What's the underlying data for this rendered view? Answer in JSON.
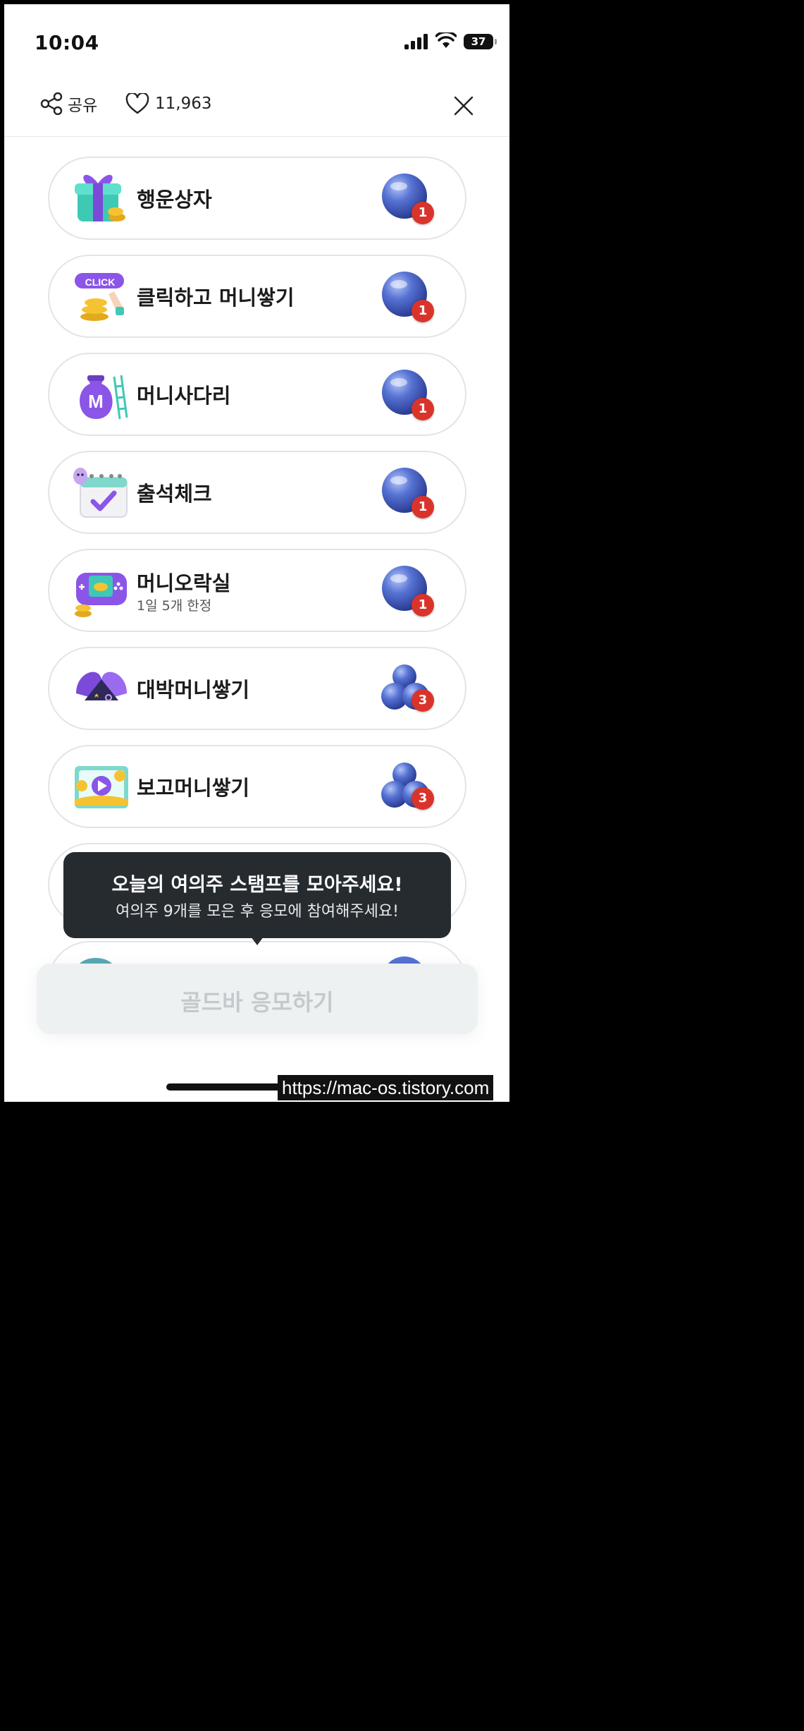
{
  "status_bar": {
    "time": "10:04",
    "battery": "37"
  },
  "header": {
    "share_label": "공유",
    "like_count": "11,963"
  },
  "items": [
    {
      "label": "행운상자",
      "icon": "gift-box-icon",
      "badge": "1",
      "orb": "single"
    },
    {
      "label": "클릭하고 머니쌓기",
      "icon": "click-coins-icon",
      "icon_text": "CLICK",
      "badge": "1",
      "orb": "single"
    },
    {
      "label": "머니사다리",
      "icon": "money-bag-ladder-icon",
      "icon_text": "M",
      "badge": "1",
      "orb": "single"
    },
    {
      "label": "출석체크",
      "icon": "calendar-check-icon",
      "badge": "1",
      "orb": "single"
    },
    {
      "label": "머니오락실",
      "sub": "1일 5개 한정",
      "icon": "game-console-icon",
      "badge": "1",
      "orb": "single"
    },
    {
      "label": "대박머니쌓기",
      "icon": "capsule-icon",
      "badge": "3",
      "orb": "triple"
    },
    {
      "label": "보고머니쌓기",
      "icon": "video-play-icon",
      "badge": "3",
      "orb": "triple"
    }
  ],
  "tooltip": {
    "title": "오늘의 여의주 스탬프를 모아주세요!",
    "desc": "여의주 9개를 모은 후 응모에 참여해주세요!"
  },
  "cta": {
    "label": "골드바 응모하기"
  },
  "watermark": "https://mac-os.tistory.com",
  "colors": {
    "badge": "#d9342b",
    "tooltip_bg": "#262b30",
    "orb": "#4a63c9",
    "cta_bg": "#eef1f2",
    "cta_text": "#c4c9cc"
  }
}
